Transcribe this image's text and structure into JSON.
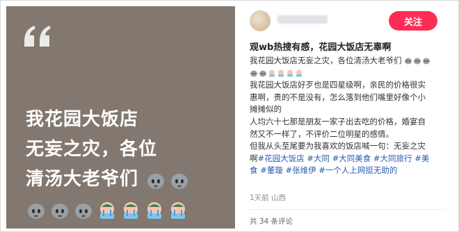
{
  "quote_card": {
    "lines": [
      "我花园大饭店",
      "无妄之灾，各位",
      "清汤大老爷们"
    ],
    "background": "#82786f"
  },
  "post": {
    "follow_label": "关注",
    "follow_color": "#ff2d55",
    "title": "观wb热搜有感，花园大饭店无辜啊",
    "body": {
      "l1": "我花园大饭店无妄之灾，各位清汤大老爷们",
      "l3": "我花园大饭店好歹也是四星级啊，亲民的价格很实",
      "l4": "惠啊，贵的不是没有，怎么落到他们嘴里好像个小",
      "l5": "摊摊似的",
      "l6": "人均六十七那是朋友一家子出去吃的价格，婚宴自",
      "l7": "然又不一样了，不评价二位明星的感情。",
      "l8": "但我从头至尾要为我喜欢的饭店喊一句：无妄之灾",
      "l9_start": "啊",
      "l10_start": "食",
      "hashtags": [
        "#花园大饭店",
        "#大同",
        "#大同美食",
        "#大同旅行",
        "#美",
        "#董璇",
        "#张维伊",
        "#一个人上网挺无助的"
      ]
    },
    "meta": "1天前 山西",
    "comments": "共 34 条评论"
  },
  "icons": {
    "quote": "quote-icon",
    "stone_face": "stone-face-emoji",
    "crying_face": "crying-face-emoji"
  }
}
